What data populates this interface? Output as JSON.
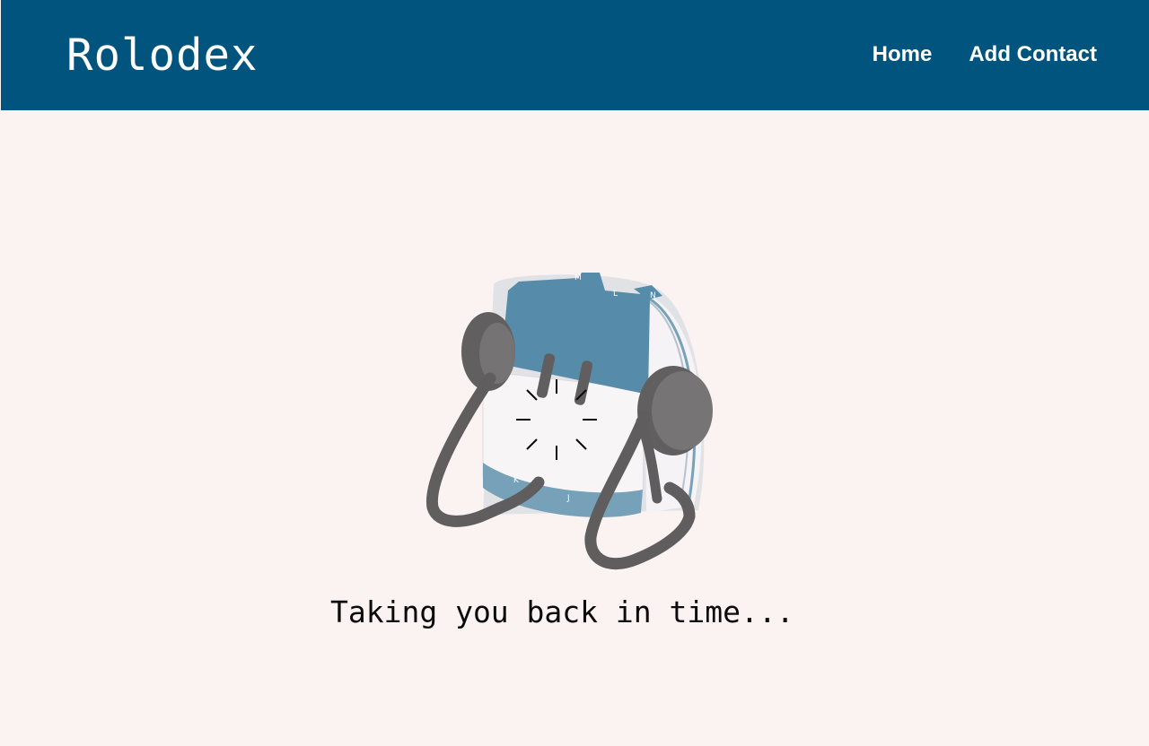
{
  "navbar": {
    "brand": "Rolodex",
    "links": [
      {
        "label": "Home"
      },
      {
        "label": "Add Contact"
      }
    ],
    "background_color": "#01547d",
    "text_color": "#ffffff"
  },
  "loading": {
    "message": "Taking you back in time...",
    "image_icon": "rolodex-card-file-image",
    "spinner_icon": "loading-spinner-icon"
  },
  "theme": {
    "page_background": "#fbf2f2",
    "card_blue": "#4c87a7"
  }
}
